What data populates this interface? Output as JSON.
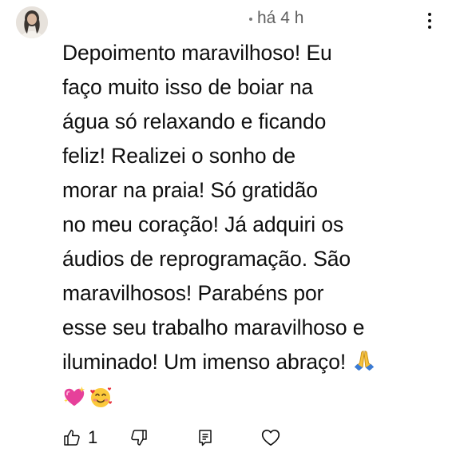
{
  "comment": {
    "timestamp": "há 4 h",
    "text_lines": [
      "Depoimento maravilhoso! Eu",
      "faço muito isso de boiar na",
      "água só relaxando e ficando",
      "feliz! Realizei o sonho de",
      "morar na praia! Só gratidão",
      "no meu coração! Já adquiri os",
      "áudios de reprogramação. São",
      "maravilhosos! Parabéns por",
      "esse seu trabalho maravilhoso e",
      "iluminado! Um imenso abraço!"
    ],
    "emojis": [
      "🙏",
      "💖",
      "🥰"
    ]
  },
  "actions": {
    "like_count": "1"
  },
  "icons": {
    "avatar": "avatar-icon",
    "menu": "more-vert-icon",
    "like": "thumb-up-icon",
    "dislike": "thumb-down-icon",
    "reply": "reply-icon",
    "heart": "heart-icon"
  }
}
